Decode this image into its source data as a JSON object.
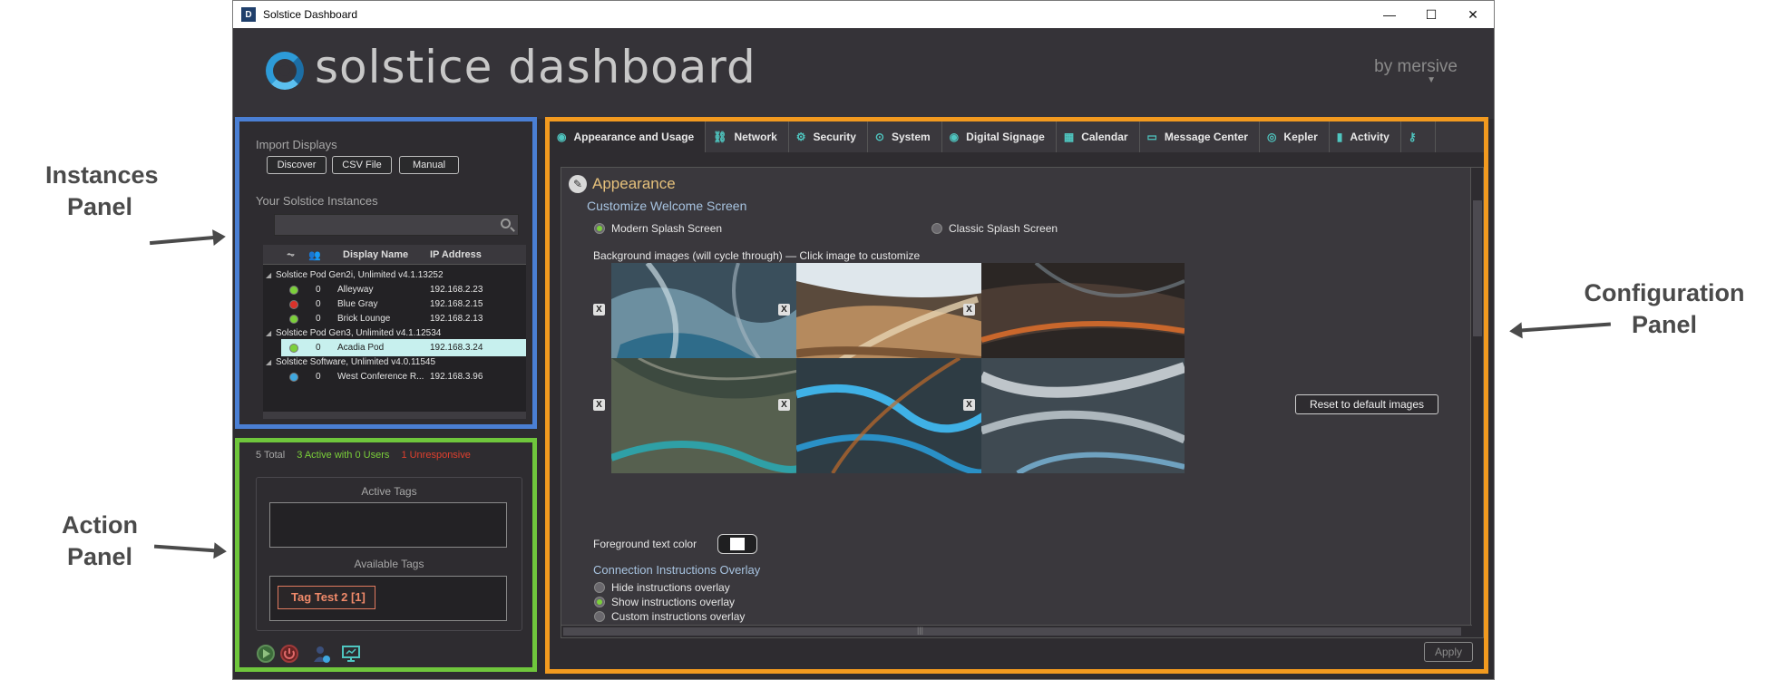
{
  "annotations": {
    "instances": "Instances Panel",
    "action": "Action Panel",
    "configuration": "Configuration Panel"
  },
  "window": {
    "title": "Solstice Dashboard",
    "app_icon_letter": "D",
    "minimize": "—",
    "maximize": "☐",
    "close": "✕"
  },
  "header": {
    "logo_text": "solstice dashboard",
    "brand": "by mersive",
    "brand_chevron": "▼"
  },
  "instances": {
    "import_label": "Import Displays",
    "buttons": {
      "discover": "Discover",
      "csv": "CSV File",
      "manual": "Manual"
    },
    "your_instances_label": "Your Solstice Instances",
    "search_value": "",
    "columns": {
      "display_name": "Display Name",
      "ip_address": "IP Address"
    },
    "groups": [
      {
        "label": "Solstice Pod Gen2i, Unlimited v4.1.13252",
        "rows": [
          {
            "status": "green",
            "users": "0",
            "name": "Alleyway",
            "ip": "192.168.2.23"
          },
          {
            "status": "red",
            "users": "0",
            "name": "Blue Gray",
            "ip": "192.168.2.15"
          },
          {
            "status": "green",
            "users": "0",
            "name": "Brick Lounge",
            "ip": "192.168.2.13"
          }
        ]
      },
      {
        "label": "Solstice Pod Gen3, Unlimited v4.1.12534",
        "rows": [
          {
            "status": "green",
            "users": "0",
            "name": "Acadia Pod",
            "ip": "192.168.3.24",
            "selected": true
          }
        ]
      },
      {
        "label": "Solstice Software, Unlimited v4.0.11545",
        "rows": [
          {
            "status": "blue",
            "users": "0",
            "name": "West Conference R...",
            "ip": "192.168.3.96"
          }
        ]
      }
    ],
    "status_colors": {
      "green": "#7bd03a",
      "red": "#d9322a",
      "blue": "#3fa8e0"
    },
    "group_triangle": "◢"
  },
  "action": {
    "total": "5 Total",
    "active": "3 Active with 0 Users",
    "unresponsive": "1 Unresponsive",
    "active_tags_label": "Active Tags",
    "available_tags_label": "Available Tags",
    "tags": [
      "Tag Test 2 [1]"
    ],
    "colors": {
      "total": "#a8a8a8",
      "active": "#7bd03a",
      "unresponsive": "#e0402e"
    }
  },
  "config": {
    "tabs": [
      {
        "label": "Appearance and Usage",
        "icon": "eye-icon",
        "glyph": "◉",
        "active": true
      },
      {
        "label": "Network",
        "icon": "network-icon",
        "glyph": "⛓"
      },
      {
        "label": "Security",
        "icon": "gear-icon",
        "glyph": "⚙"
      },
      {
        "label": "System",
        "icon": "system-icon",
        "glyph": "⊙"
      },
      {
        "label": "Digital Signage",
        "icon": "eye-icon",
        "glyph": "◉"
      },
      {
        "label": "Calendar",
        "icon": "calendar-icon",
        "glyph": "▦"
      },
      {
        "label": "Message Center",
        "icon": "message-icon",
        "glyph": "▭"
      },
      {
        "label": "Kepler",
        "icon": "kepler-icon",
        "glyph": "◎"
      },
      {
        "label": "Activity",
        "icon": "chart-icon",
        "glyph": "▮"
      },
      {
        "label": "",
        "icon": "key-icon",
        "glyph": "⚷"
      }
    ],
    "section_title": "Appearance",
    "welcome_heading": "Customize Welcome Screen",
    "splash": {
      "modern": "Modern Splash Screen",
      "classic": "Classic Splash Screen",
      "selected": "modern"
    },
    "bg_images_label": "Background images (will cycle through) — Click image to customize",
    "remove_label": "X",
    "reset_button": "Reset to default images",
    "foreground_label": "Foreground text color",
    "overlay_heading": "Connection Instructions Overlay",
    "overlay_options": [
      "Hide instructions overlay",
      "Show instructions overlay",
      "Custom instructions overlay"
    ],
    "overlay_selected": 1,
    "apply_button": "Apply",
    "scroll_grip": "|||"
  }
}
